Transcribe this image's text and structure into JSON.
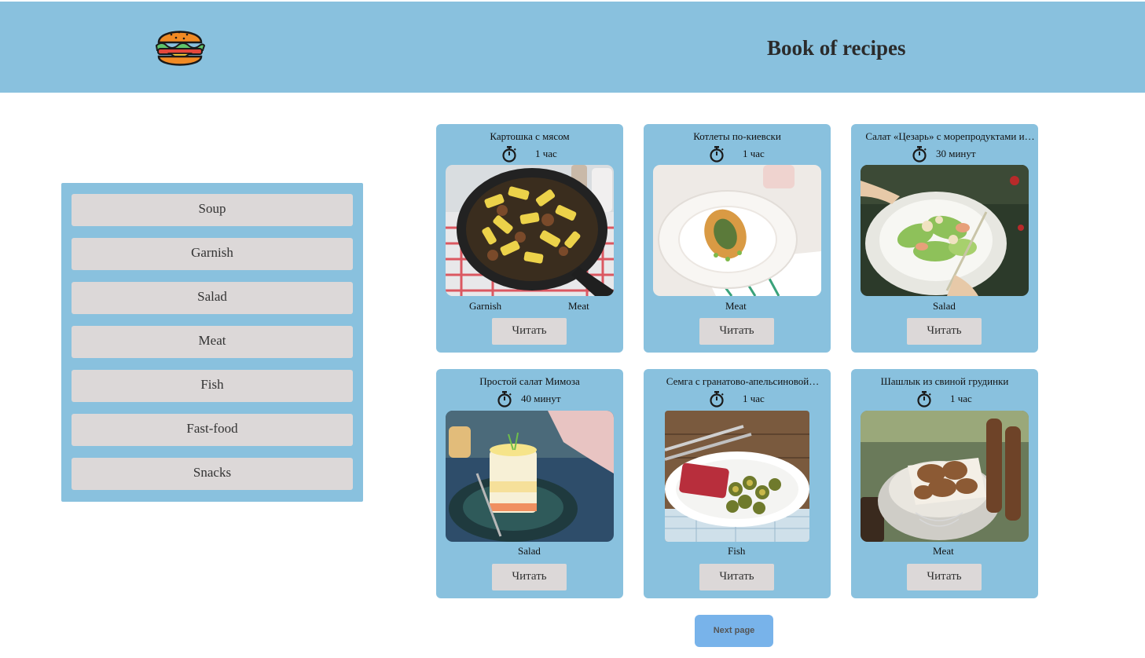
{
  "header": {
    "logo_icon": "burger-icon",
    "title": "Book of recipes",
    "background": "#89c1de"
  },
  "sidebar": {
    "categories": [
      "Soup",
      "Garnish",
      "Salad",
      "Meat",
      "Fish",
      "Fast-food",
      "Snacks"
    ]
  },
  "recipes": [
    {
      "title": "Картошка с мясом",
      "time": "1 час",
      "tags": [
        "Garnish",
        "Meat"
      ],
      "button": "Читать",
      "image": "potatoes-with-meat-photo"
    },
    {
      "title": "Котлеты по-киевски",
      "time": "1 час",
      "tags": [
        "Meat"
      ],
      "button": "Читать",
      "image": "chicken-kiev-photo"
    },
    {
      "title": "Салат «Цезарь» с морепродуктами и…",
      "time": "30 минут",
      "tags": [
        "Salad"
      ],
      "button": "Читать",
      "image": "caesar-salad-photo"
    },
    {
      "title": "Простой салат Мимоза",
      "time": "40 минут",
      "tags": [
        "Salad"
      ],
      "button": "Читать",
      "image": "mimosa-salad-photo"
    },
    {
      "title": "Семга с гранатово-апельсиновой…",
      "time": "1 час",
      "tags": [
        "Fish"
      ],
      "button": "Читать",
      "image": "salmon-photo"
    },
    {
      "title": "Шашлык из свиной грудинки",
      "time": "1 час",
      "tags": [
        "Meat"
      ],
      "button": "Читать",
      "image": "pork-shashlik-photo"
    }
  ],
  "pagination": {
    "next_label": "Next page"
  },
  "colors": {
    "accent": "#89c1de",
    "button_grey": "#dcd8d8",
    "next_button": "#78b3ea"
  }
}
